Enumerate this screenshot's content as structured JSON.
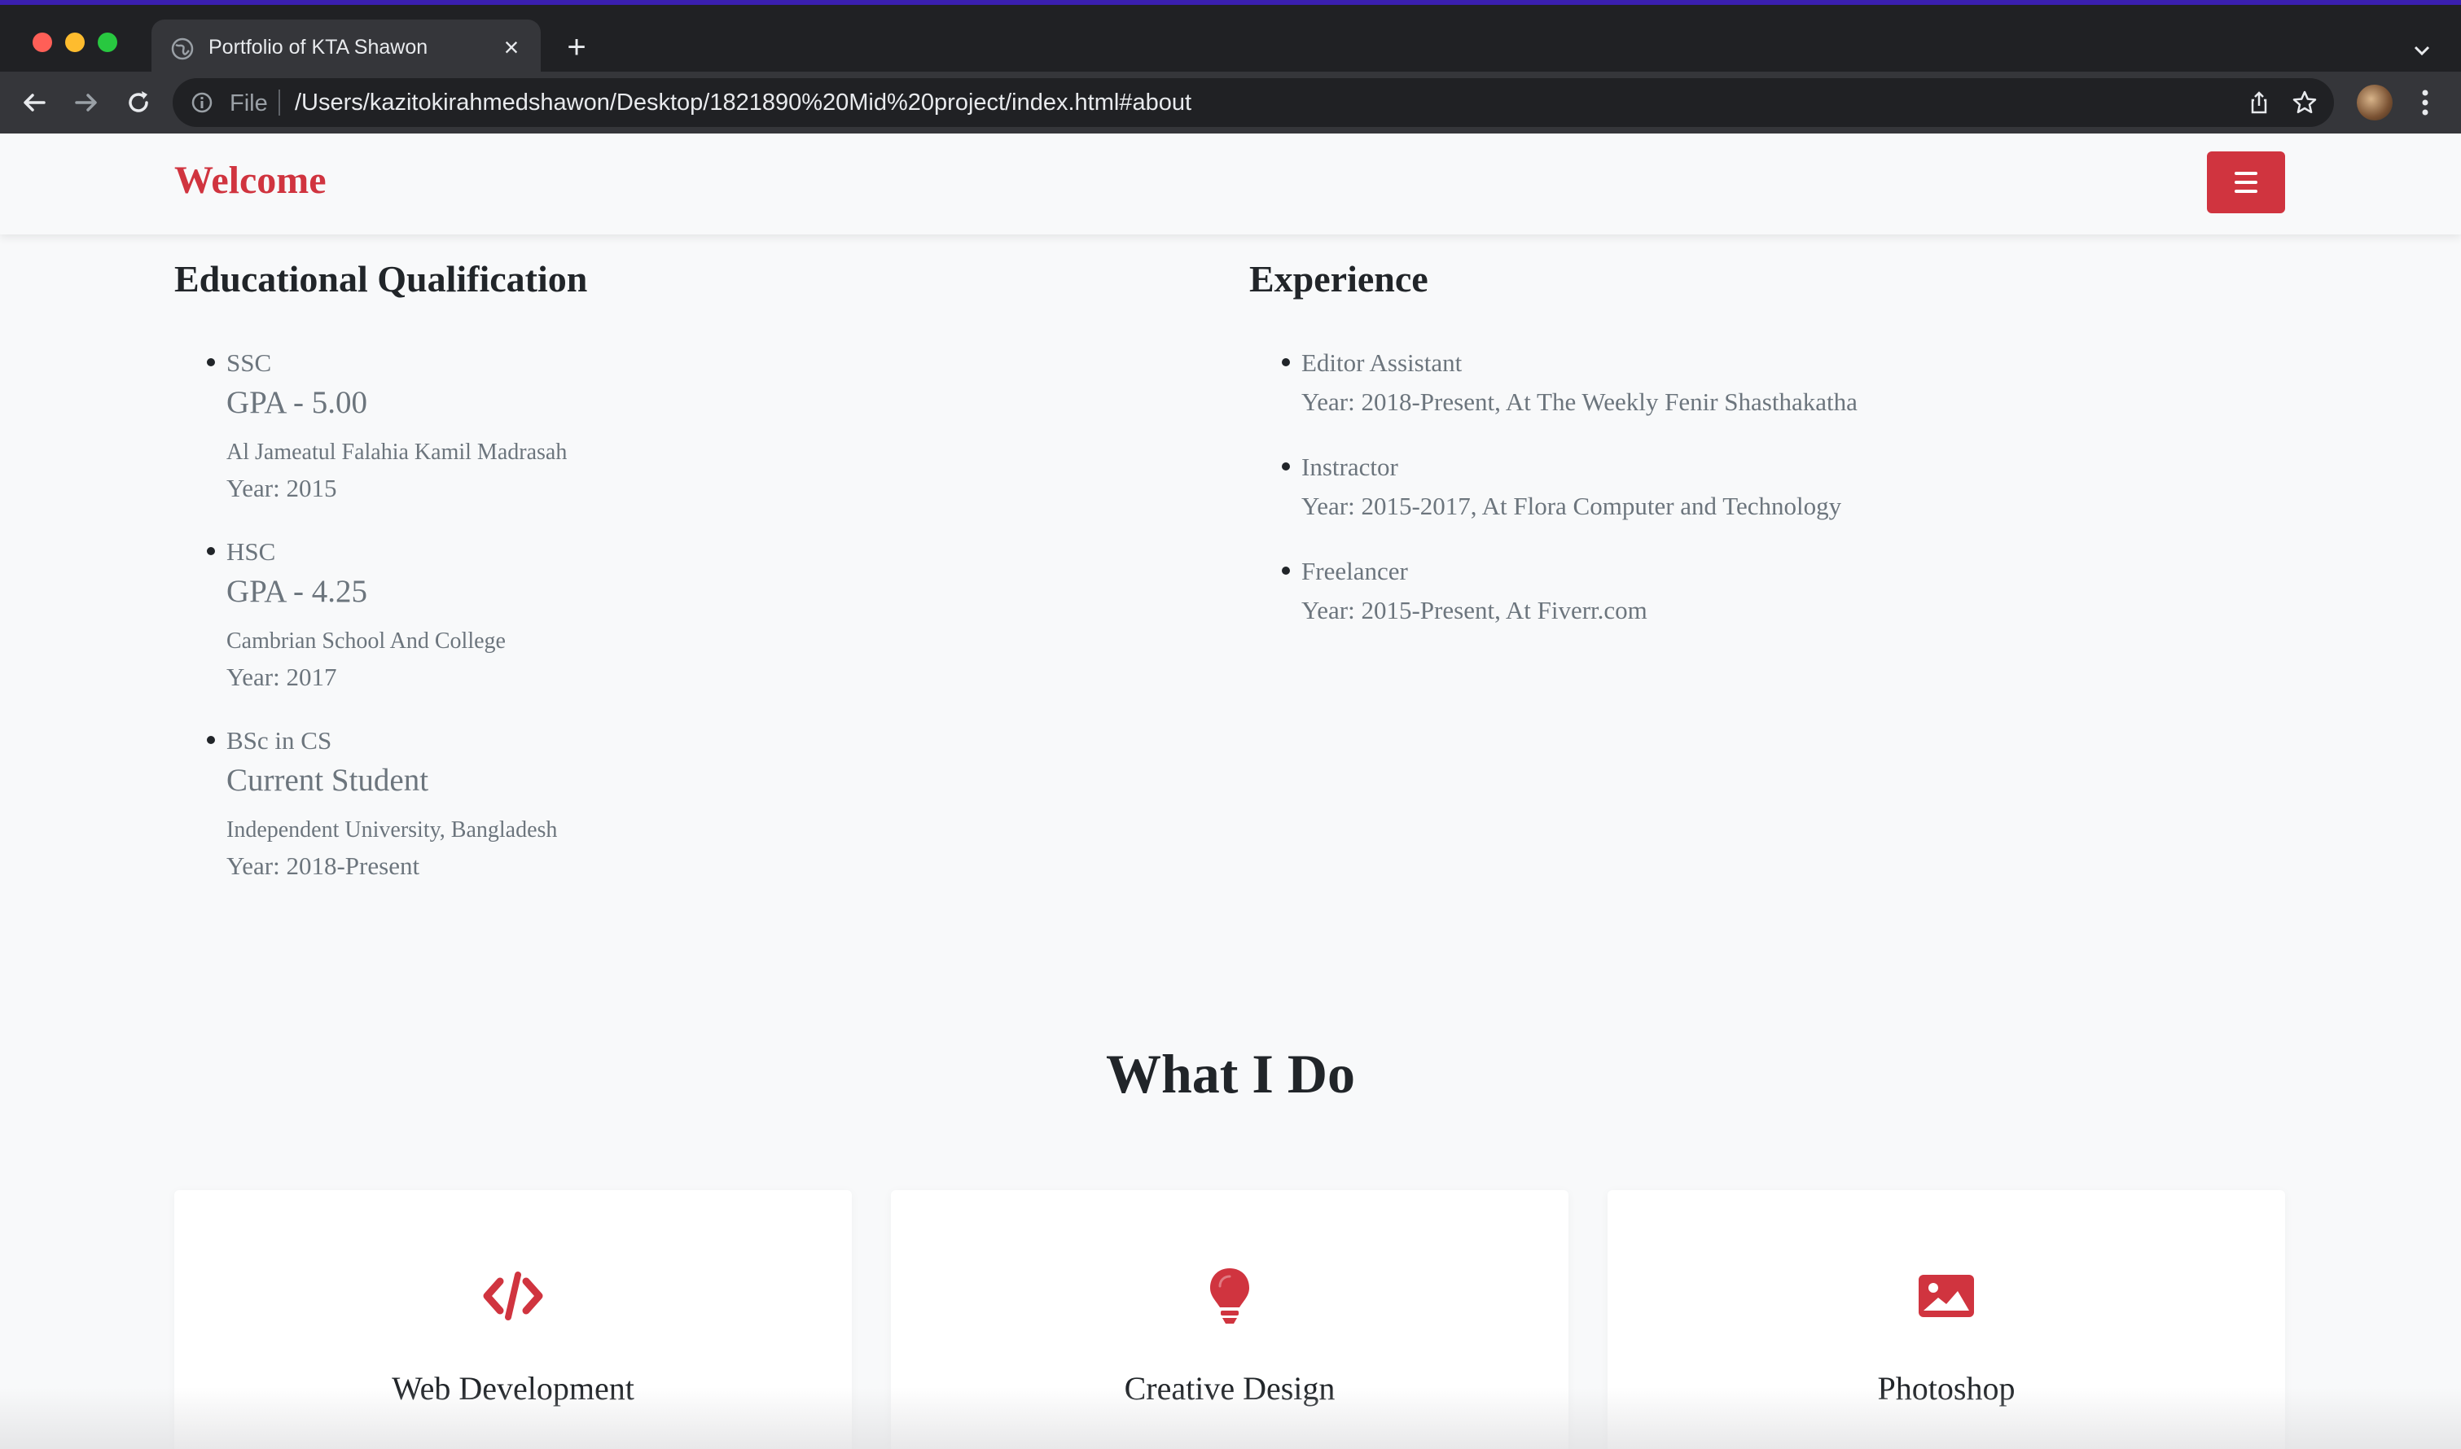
{
  "browser": {
    "tab_title": "Portfolio of KTA Shawon",
    "address_scheme": "File",
    "address_url": "/Users/kazitokirahmedshawon/Desktop/1821890%20Mid%20project/index.html#about",
    "new_tab_glyph": "+",
    "close_glyph": "×"
  },
  "navbar": {
    "brand": "Welcome",
    "accent_color": "#d0343f"
  },
  "education": {
    "title": "Educational Qualification",
    "items": [
      {
        "name": "SSC",
        "grade": "GPA - 5.00",
        "school": "Al Jameatul Falahia Kamil Madrasah",
        "year": "Year: 2015"
      },
      {
        "name": "HSC",
        "grade": "GPA - 4.25",
        "school": "Cambrian School And College",
        "year": "Year: 2017"
      },
      {
        "name": "BSc in CS",
        "grade": "Current Student",
        "school": "Independent University, Bangladesh",
        "year": "Year: 2018-Present"
      }
    ]
  },
  "experience": {
    "title": "Experience",
    "items": [
      {
        "title": "Editor Assistant",
        "detail": "Year: 2018-Present, At The Weekly Fenir Shasthakatha"
      },
      {
        "title": "Instractor",
        "detail": "Year: 2015-2017, At Flora Computer and Technology"
      },
      {
        "title": "Freelancer",
        "detail": "Year: 2015-Present, At Fiverr.com"
      }
    ]
  },
  "services": {
    "heading": "What I Do",
    "cards": [
      {
        "title": "Web Development",
        "icon": "code-icon"
      },
      {
        "title": "Creative Design",
        "icon": "lightbulb-icon"
      },
      {
        "title": "Photoshop",
        "icon": "image-icon"
      }
    ]
  }
}
